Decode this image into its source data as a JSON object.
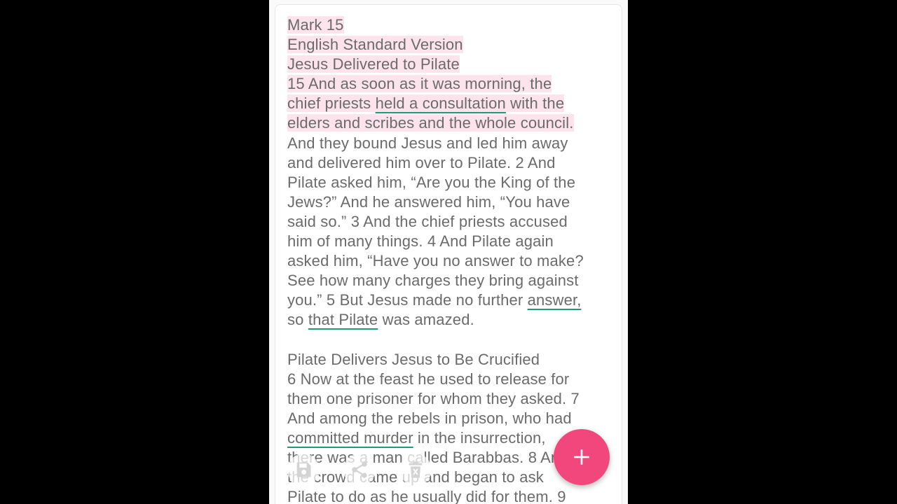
{
  "colors": {
    "highlight": "#fde3ec",
    "underline": "#1f9a74",
    "text": "#6b6b6b",
    "fab": "#f2477c"
  },
  "note": {
    "title": "Mark 15",
    "version": "English Standard Version",
    "heading1": "Jesus Delivered to Pilate",
    "p1": {
      "s1a": "15 And as soon as it was morning, the",
      "s1b": "chief priests ",
      "u1": "held a consultation",
      "s1c": " with the",
      "s1d": "elders and scribes and the whole council.",
      "s2": "And they bound Jesus and led him away",
      "s3": "and delivered him over to Pilate. 2 And",
      "s4": "Pilate asked him, “Are you the King of the",
      "s5": "Jews?” And he answered him, “You have",
      "s6": "said so.” 3 And the chief priests accused",
      "s7": "him of many things. 4 And Pilate again",
      "s8": "asked him, “Have you no answer to make?",
      "s9": "See how many charges they bring against",
      "s10a": "you.” 5 But Jesus made no further ",
      "u2": "answer,",
      "s11a": "so ",
      "u3": "that Pilate",
      "s11b": " was amazed."
    },
    "heading2": "Pilate Delivers Jesus to Be Crucified",
    "p2": {
      "s1": "6 Now at the feast he used to release for",
      "s2": "them one prisoner for whom they asked. 7",
      "s3": "And among the rebels in prison, who had",
      "u4": "committed murder",
      "s4b": " in the insurrection,",
      "s5": "there was a man called Barabbas. 8 And",
      "s6": "the crowd came up and began to ask",
      "s7": "Pilate to do as he usually did for them. 9"
    }
  },
  "toolbar": {
    "save_icon": "save-icon",
    "share_icon": "share-icon",
    "delete_icon": "trash-icon"
  },
  "fab": {
    "icon": "plus-icon"
  }
}
